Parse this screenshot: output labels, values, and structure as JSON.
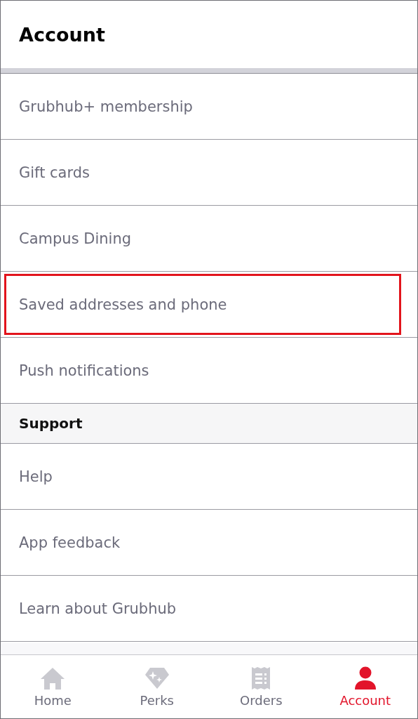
{
  "title": "Account",
  "sections": [
    {
      "items": [
        {
          "label": "Grubhub+ membership",
          "highlighted": false
        },
        {
          "label": "Gift cards",
          "highlighted": false
        },
        {
          "label": "Campus Dining",
          "highlighted": false
        },
        {
          "label": "Saved addresses and phone",
          "highlighted": true
        },
        {
          "label": "Push notifications",
          "highlighted": false
        }
      ]
    },
    {
      "heading": "Support",
      "items": [
        {
          "label": "Help",
          "highlighted": false
        },
        {
          "label": "App feedback",
          "highlighted": false
        },
        {
          "label": "Learn about Grubhub",
          "highlighted": false
        }
      ]
    }
  ],
  "nav": [
    {
      "kind": "home",
      "label": "Home",
      "selected": false
    },
    {
      "kind": "perks",
      "label": "Perks",
      "selected": false
    },
    {
      "kind": "orders",
      "label": "Orders",
      "selected": false
    },
    {
      "kind": "account",
      "label": "Account",
      "selected": true
    }
  ]
}
